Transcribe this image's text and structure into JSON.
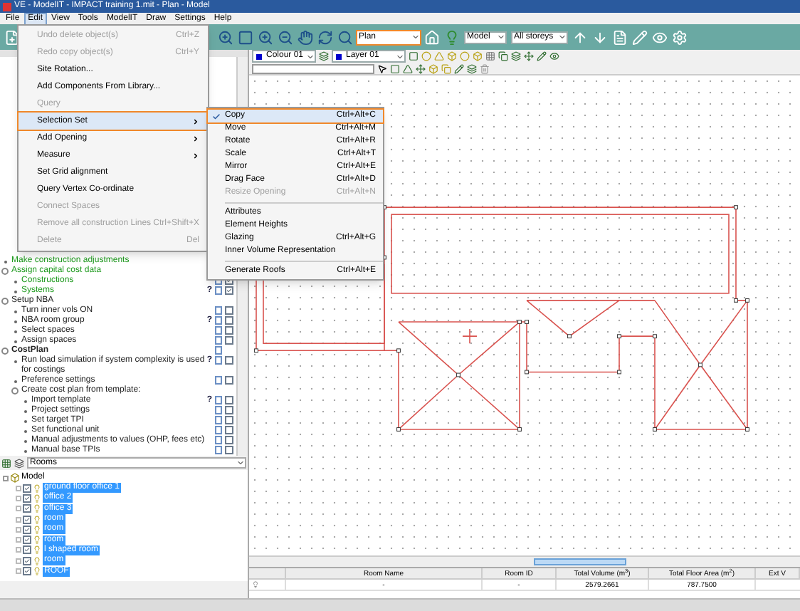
{
  "window": {
    "title": "VE - ModelIT - IMPACT training 1.mit - Plan - Model"
  },
  "menu_bar": [
    {
      "label": "File",
      "selected": false
    },
    {
      "label": "Edit",
      "selected": true
    },
    {
      "label": "View",
      "selected": false
    },
    {
      "label": "Tools",
      "selected": false
    },
    {
      "label": "ModelIT",
      "selected": false
    },
    {
      "label": "Draw",
      "selected": false
    },
    {
      "label": "Settings",
      "selected": false
    },
    {
      "label": "Help",
      "selected": false
    }
  ],
  "toolbar": {
    "view_dropdown": {
      "value": "Plan",
      "highlighted": true
    },
    "model_dropdown": {
      "value": "Model"
    },
    "storey_dropdown": {
      "value": "All storeys"
    }
  },
  "layer_toolbar": {
    "colour_dropdown": {
      "value": "Colour 01"
    },
    "layer_dropdown": {
      "value": "Layer 01"
    }
  },
  "workflow": [
    {
      "kind": "task",
      "label": "Make construction adjustments",
      "done": true
    },
    {
      "kind": "group",
      "label": "Assign capital cost data",
      "done": true,
      "children": [
        {
          "kind": "task",
          "label": "Constructions",
          "done": true,
          "checked": true
        },
        {
          "kind": "task",
          "label": "Systems",
          "done": true,
          "checked": true,
          "help": "?"
        }
      ]
    },
    {
      "kind": "group",
      "label": "Setup NBA",
      "done": false,
      "children": [
        {
          "kind": "task",
          "label": "Turn inner vols ON",
          "done": false,
          "checked": false
        },
        {
          "kind": "task",
          "label": "NBA room group",
          "done": false,
          "checked": false,
          "help": "?"
        },
        {
          "kind": "task",
          "label": "Select spaces",
          "done": false,
          "checked": false
        },
        {
          "kind": "task",
          "label": "Assign spaces",
          "done": false,
          "checked": false
        }
      ]
    },
    {
      "kind": "section",
      "label": "CostPlan",
      "done": false,
      "children": [
        {
          "kind": "task",
          "label": "Run load simulation if system complexity is used for costings",
          "done": false,
          "checked": false,
          "help": "?"
        },
        {
          "kind": "task",
          "label": "Preference settings",
          "done": false,
          "checked": false
        },
        {
          "kind": "group",
          "label": "Create cost plan from template:",
          "done": false,
          "children": [
            {
              "kind": "task",
              "label": "Import template",
              "done": false,
              "checked": false,
              "help": "?"
            },
            {
              "kind": "task",
              "label": "Project settings",
              "done": false,
              "checked": false
            },
            {
              "kind": "task",
              "label": "Set target TPI",
              "done": false,
              "checked": false
            },
            {
              "kind": "task",
              "label": "Set functional unit",
              "done": false,
              "checked": false
            },
            {
              "kind": "task",
              "label": "Manual adjustments to values (OHP, fees etc)",
              "done": false,
              "checked": false
            },
            {
              "kind": "task",
              "label": "Manual base TPIs",
              "done": false,
              "checked": false
            }
          ]
        }
      ]
    }
  ],
  "rooms_panel": {
    "dropdown": "Rooms",
    "tree": {
      "label": "Model",
      "expanded": true,
      "children": [
        {
          "label": "ground floor office 1",
          "checked": true,
          "selected": true
        },
        {
          "label": "office 2",
          "checked": true,
          "selected": true
        },
        {
          "label": "office 3",
          "checked": true,
          "selected": true
        },
        {
          "label": "room",
          "checked": true,
          "selected": true
        },
        {
          "label": "room",
          "checked": true,
          "selected": true
        },
        {
          "label": "room",
          "checked": true,
          "selected": true
        },
        {
          "label": "l shaped room",
          "checked": true,
          "selected": true
        },
        {
          "label": "room",
          "checked": true,
          "selected": true
        },
        {
          "label": "ROOF",
          "checked": true,
          "selected": true
        }
      ]
    }
  },
  "table": {
    "columns": [
      "Room Name",
      "Room ID",
      "Total Volume (m$^{3}$)",
      "Total Floor Area (m$^{2}$)",
      "Ext V"
    ],
    "rows": [
      [
        "-",
        "-",
        "2579.2661",
        "787.7500"
      ]
    ]
  },
  "edit_menu": {
    "items": [
      {
        "kind": "item",
        "label": "Undo delete object(s)",
        "shortcut": "Ctrl+Z",
        "disabled": true,
        "submenu": false,
        "selected": false
      },
      {
        "kind": "item",
        "label": "Redo copy object(s)",
        "shortcut": "Ctrl+Y",
        "disabled": true,
        "submenu": false,
        "selected": false
      },
      {
        "kind": "item",
        "label": "Site Rotation...",
        "disabled": false,
        "submenu": false,
        "selected": false
      },
      {
        "kind": "item",
        "label": "Add Components From Library...",
        "disabled": false,
        "submenu": false,
        "selected": false
      },
      {
        "kind": "item",
        "label": "Query",
        "disabled": true,
        "submenu": false,
        "selected": false
      },
      {
        "kind": "item",
        "label": "Selection Set",
        "disabled": false,
        "submenu": true,
        "selected": true
      },
      {
        "kind": "item",
        "label": "Add Opening",
        "disabled": false,
        "submenu": true,
        "selected": false
      },
      {
        "kind": "item",
        "label": "Measure",
        "disabled": false,
        "submenu": true,
        "selected": false
      },
      {
        "kind": "item",
        "label": "Set Grid alignment",
        "disabled": false,
        "submenu": false,
        "selected": false
      },
      {
        "kind": "item",
        "label": "Query Vertex Co-ordinate",
        "disabled": false,
        "submenu": false,
        "selected": false
      },
      {
        "kind": "item",
        "label": "Connect Spaces",
        "disabled": true,
        "submenu": false,
        "selected": false
      },
      {
        "kind": "item",
        "label": "Remove all construction Lines",
        "shortcut": "Ctrl+Shift+X",
        "disabled": true,
        "submenu": false,
        "selected": false
      },
      {
        "kind": "item",
        "label": "Delete",
        "shortcut": "Del",
        "disabled": true,
        "submenu": false,
        "selected": false
      }
    ]
  },
  "selection_set_submenu": {
    "items": [
      {
        "kind": "item",
        "label": "Copy",
        "shortcut": "Ctrl+Alt+C",
        "checked": true,
        "selected": true,
        "disabled": false
      },
      {
        "kind": "item",
        "label": "Move",
        "shortcut": "Ctrl+Alt+M",
        "checked": false,
        "selected": false,
        "disabled": false
      },
      {
        "kind": "item",
        "label": "Rotate",
        "shortcut": "Ctrl+Alt+R",
        "checked": false,
        "selected": false,
        "disabled": false
      },
      {
        "kind": "item",
        "label": "Scale",
        "shortcut": "Ctrl+Alt+T",
        "checked": false,
        "selected": false,
        "disabled": false
      },
      {
        "kind": "item",
        "label": "Mirror",
        "shortcut": "Ctrl+Alt+E",
        "checked": false,
        "selected": false,
        "disabled": false
      },
      {
        "kind": "item",
        "label": "Drag Face",
        "shortcut": "Ctrl+Alt+D",
        "checked": false,
        "selected": false,
        "disabled": false
      },
      {
        "kind": "item",
        "label": "Resize Opening",
        "shortcut": "Ctrl+Alt+N",
        "checked": false,
        "selected": false,
        "disabled": true
      },
      {
        "kind": "separator"
      },
      {
        "kind": "item",
        "label": "Attributes",
        "checked": false,
        "selected": false,
        "disabled": false
      },
      {
        "kind": "item",
        "label": "Element Heights",
        "checked": false,
        "selected": false,
        "disabled": false
      },
      {
        "kind": "item",
        "label": "Glazing",
        "shortcut": "Ctrl+Alt+G",
        "checked": false,
        "selected": false,
        "disabled": false
      },
      {
        "kind": "item",
        "label": "Inner Volume Representation",
        "checked": false,
        "selected": false,
        "disabled": false
      },
      {
        "kind": "separator"
      },
      {
        "kind": "item",
        "label": "Generate Roofs",
        "shortcut": "Ctrl+Alt+E",
        "checked": false,
        "selected": false,
        "disabled": false
      }
    ]
  }
}
